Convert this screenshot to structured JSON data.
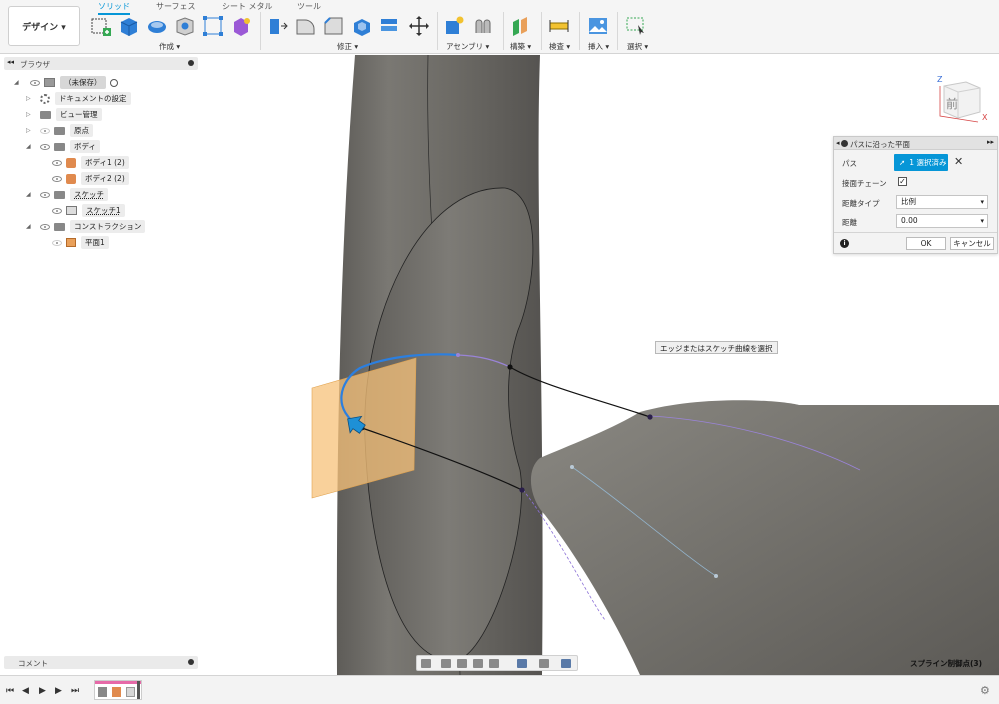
{
  "workspace": {
    "label": "デザイン ▾"
  },
  "tabs": [
    {
      "label": "ソリッド",
      "active": true
    },
    {
      "label": "サーフェス",
      "active": false
    },
    {
      "label": "シート メタル",
      "active": false
    },
    {
      "label": "ツール",
      "active": false
    }
  ],
  "toolbar_groups": {
    "create": "作成 ▾",
    "modify": "修正 ▾",
    "assemble": "アセンブリ ▾",
    "construct": "構築 ▾",
    "inspect": "検査 ▾",
    "insert": "挿入 ▾",
    "select": "選択 ▾"
  },
  "browser": {
    "title": "ブラウザ",
    "items": [
      {
        "label": "（未保存）"
      },
      {
        "label": "ドキュメントの設定"
      },
      {
        "label": "ビュー管理"
      },
      {
        "label": "原点"
      },
      {
        "label": "ボディ"
      },
      {
        "label": "ボディ1 (2)"
      },
      {
        "label": "ボディ2 (2)"
      },
      {
        "label": "スケッチ"
      },
      {
        "label": "スケッチ1"
      },
      {
        "label": "コンストラクション"
      },
      {
        "label": "平面1"
      }
    ]
  },
  "comments": {
    "title": "コメント"
  },
  "dialog": {
    "title": "パスに沿った平面",
    "path_label": "パス",
    "path_value": "1 選択済み",
    "chain_label": "接面チェーン",
    "chain_checked": "✓",
    "distance_type_label": "距離タイプ",
    "distance_type_value": "比例",
    "distance_label": "距離",
    "distance_value": "0.00",
    "ok": "OK",
    "cancel": "キャンセル"
  },
  "tooltip": "エッジまたはスケッチ曲線を選択",
  "status": "スプライン制御点(3)",
  "viewcube": {
    "face": "前",
    "x_axis": "X",
    "z_axis": "Z"
  },
  "colors": {
    "accent": "#0696d7",
    "body_gray": "#6f6d68",
    "plane_orange": "#f7c27a",
    "path_blue": "#2b7fe0"
  }
}
